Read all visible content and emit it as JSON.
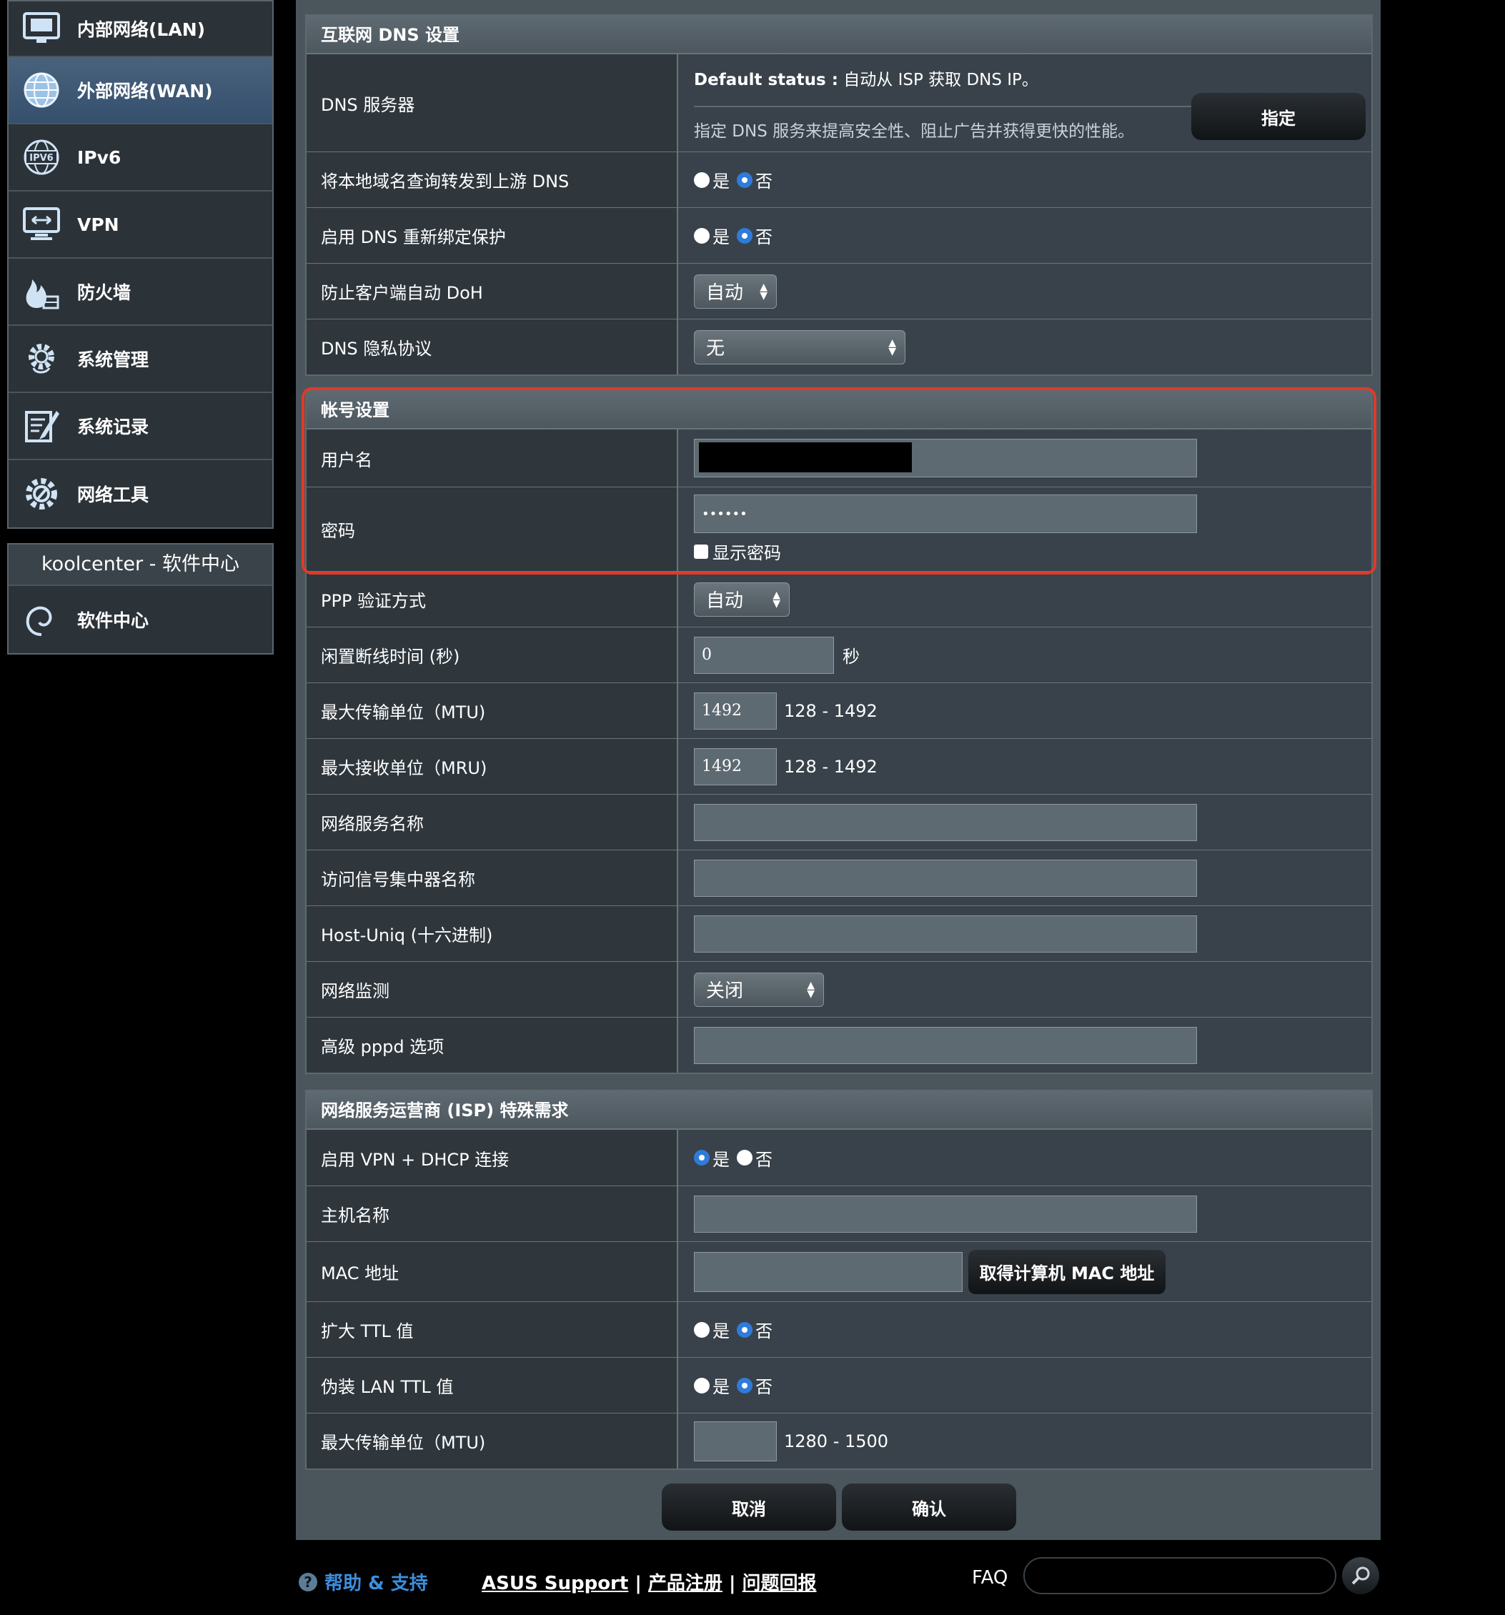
{
  "sidebar": {
    "items": [
      {
        "label": "内部网络(LAN)",
        "icon": "lan-icon"
      },
      {
        "label": "外部网络(WAN)",
        "icon": "globe-icon"
      },
      {
        "label": "IPv6",
        "icon": "ipv6-icon"
      },
      {
        "label": "VPN",
        "icon": "vpn-icon"
      },
      {
        "label": "防火墙",
        "icon": "firewall-icon"
      },
      {
        "label": "系统管理",
        "icon": "gear-icon"
      },
      {
        "label": "系统记录",
        "icon": "log-icon"
      },
      {
        "label": "网络工具",
        "icon": "tools-icon"
      }
    ],
    "koolcenter_title": "koolcenter - 软件中心",
    "software_center": "软件中心"
  },
  "dns": {
    "header": "互联网 DNS 设置",
    "server_label": "DNS 服务器",
    "default_status_prefix": "Default status :",
    "default_status_text": " 自动从 ISP 获取 DNS IP。",
    "hint": "指定 DNS 服务来提高安全性、阻止广告并获得更快的性能。",
    "assign_button": "指定",
    "forward_label": "将本地域名查询转发到上游 DNS",
    "rebind_label": "启用 DNS 重新绑定保护",
    "doh_label": "防止客户端自动 DoH",
    "doh_value": "自动",
    "privacy_label": "DNS 隐私协议",
    "privacy_value": "无"
  },
  "common": {
    "yes": "是",
    "no": "否"
  },
  "account": {
    "header": "帐号设置",
    "username_label": "用户名",
    "password_label": "密码",
    "password_value": "••••••",
    "show_password": "显示密码",
    "highlight_color": "#e0392b"
  },
  "ppp": {
    "auth_label": "PPP 验证方式",
    "auth_value": "自动",
    "idle_label": "闲置断线时间 (秒)",
    "idle_value": "0",
    "idle_unit": "秒",
    "mtu_label": "最大传输单位（MTU)",
    "mtu_value": "1492",
    "mtu_range": "128 - 1492",
    "mru_label": "最大接收单位（MRU)",
    "mru_value": "1492",
    "mru_range": "128 - 1492",
    "service_label": "网络服务名称",
    "ac_label": "访问信号集中器名称",
    "hostuniq_label": "Host-Uniq (十六进制)",
    "monitor_label": "网络监测",
    "monitor_value": "关闭",
    "pppd_label": "高级 pppd 选项"
  },
  "isp": {
    "header": "网络服务运营商 (ISP) 特殊需求",
    "vpn_dhcp_label": "启用 VPN + DHCP 连接",
    "hostname_label": "主机名称",
    "mac_label": "MAC 地址",
    "mac_button": "取得计算机 MAC 地址",
    "ttl_label": "扩大 TTL 值",
    "lan_ttl_label": "伪装 LAN TTL 值",
    "mtu_label": "最大传输单位（MTU)",
    "mtu_range": "1280 - 1500"
  },
  "actions": {
    "cancel": "取消",
    "confirm": "确认"
  },
  "footer": {
    "help": "帮助 & 支持",
    "asus_support": "ASUS Support",
    "separator": " | ",
    "register": "产品注册",
    "feedback": "问题回报",
    "faq": "FAQ"
  }
}
